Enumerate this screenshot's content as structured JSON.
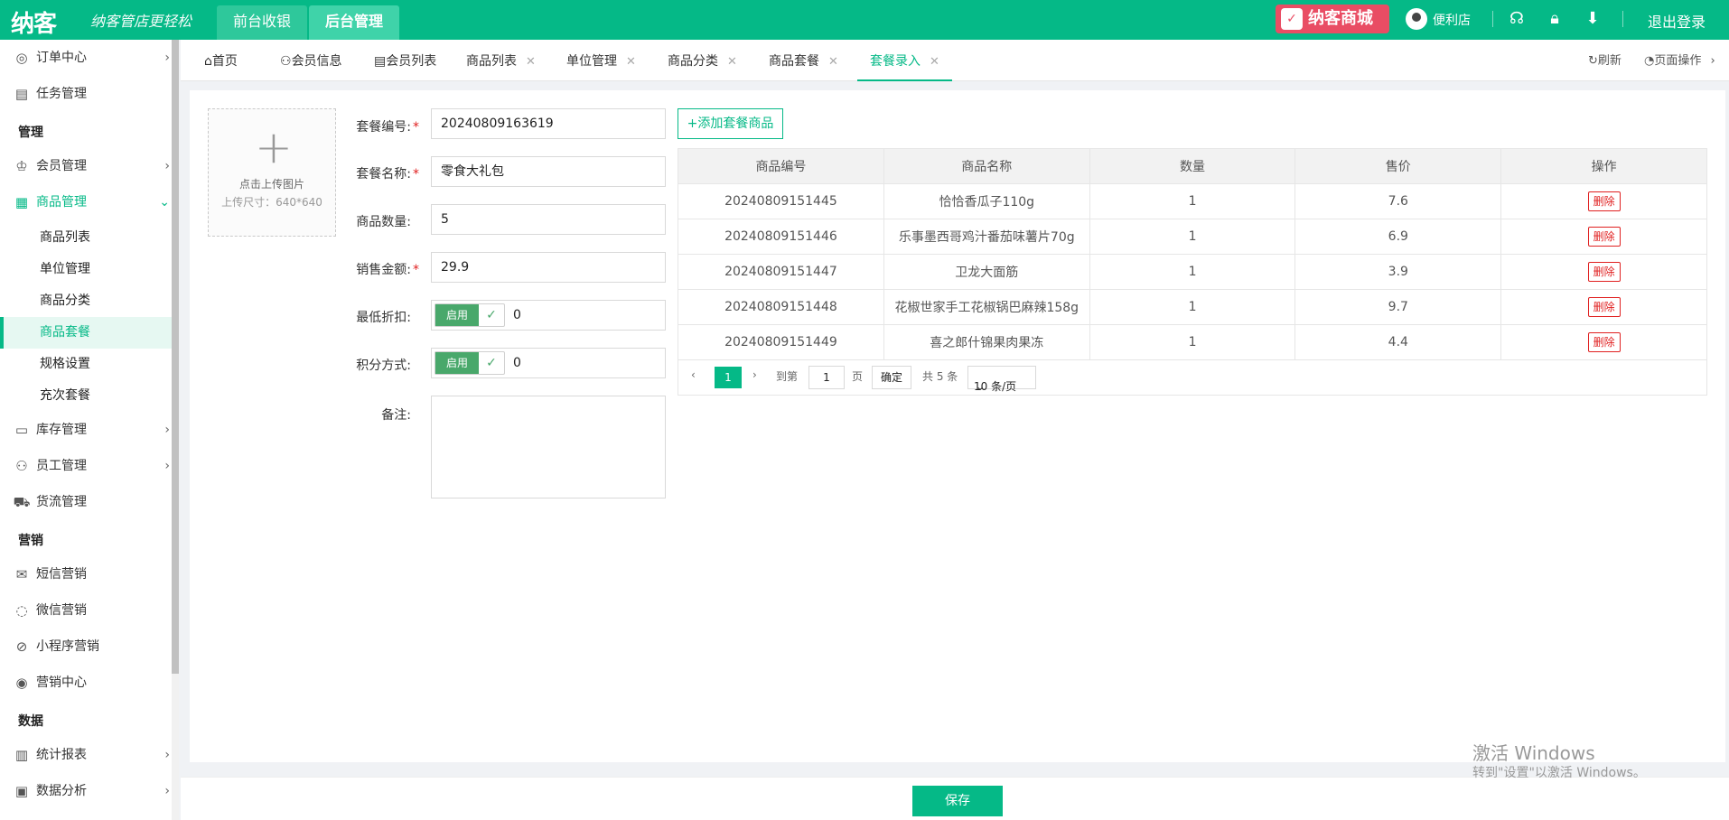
{
  "header": {
    "logo": "纳客",
    "slogan": "纳客管店更轻松",
    "nav_front": "前台收银",
    "nav_back": "后台管理",
    "mall": "纳客商城",
    "user": "便利店",
    "logout": "退出登录"
  },
  "sidebar": {
    "order_center": "订单中心",
    "task_manage": "任务管理",
    "group_manage": "管理",
    "member_manage": "会员管理",
    "goods_manage": "商品管理",
    "goods_list": "商品列表",
    "unit_manage": "单位管理",
    "goods_category": "商品分类",
    "goods_package": "商品套餐",
    "spec_setting": "规格设置",
    "recharge_package": "充次套餐",
    "stock_manage": "库存管理",
    "staff_manage": "员工管理",
    "logistics_manage": "货流管理",
    "group_marketing": "营销",
    "sms_marketing": "短信营销",
    "wechat_marketing": "微信营销",
    "miniapp_marketing": "小程序营销",
    "marketing_center": "营销中心",
    "group_data": "数据",
    "stat_report": "统计报表",
    "data_analysis": "数据分析"
  },
  "tabs": {
    "home": "首页",
    "member_info": "会员信息",
    "member_list": "会员列表",
    "goods_list": "商品列表",
    "unit_manage": "单位管理",
    "goods_category": "商品分类",
    "goods_package": "商品套餐",
    "package_entry": "套餐录入",
    "refresh": "刷新",
    "page_ops": "页面操作"
  },
  "upload": {
    "text": "点击上传图片",
    "size": "上传尺寸：640*640"
  },
  "form": {
    "code_label": "套餐编号:",
    "code_value": "20240809163619",
    "name_label": "套餐名称:",
    "name_value": "零食大礼包",
    "qty_label": "商品数量:",
    "qty_value": "5",
    "amount_label": "销售金额:",
    "amount_value": "29.9",
    "discount_label": "最低折扣:",
    "discount_toggle": "启用",
    "discount_value": "0",
    "points_label": "积分方式:",
    "points_toggle": "启用",
    "points_value": "0",
    "remark_label": "备注:"
  },
  "add_button": "+添加套餐商品",
  "table": {
    "headers": [
      "商品编号",
      "商品名称",
      "数量",
      "售价",
      "操作"
    ],
    "rows": [
      {
        "code": "20240809151445",
        "name": "恰恰香瓜子110g",
        "qty": "1",
        "price": "7.6",
        "action": "删除"
      },
      {
        "code": "20240809151446",
        "name": "乐事墨西哥鸡汁番茄味薯片70g",
        "qty": "1",
        "price": "6.9",
        "action": "删除"
      },
      {
        "code": "20240809151447",
        "name": "卫龙大面筋",
        "qty": "1",
        "price": "3.9",
        "action": "删除"
      },
      {
        "code": "20240809151448",
        "name": "花椒世家手工花椒锅巴麻辣158g",
        "qty": "1",
        "price": "9.7",
        "action": "删除"
      },
      {
        "code": "20240809151449",
        "name": "喜之郎什锦果肉果冻",
        "qty": "1",
        "price": "4.4",
        "action": "删除"
      }
    ]
  },
  "pager": {
    "current": "1",
    "goto": "到第",
    "page_input": "1",
    "page_unit": "页",
    "confirm": "确定",
    "total": "共 5 条",
    "page_size": "10 条/页"
  },
  "save_button": "保存",
  "watermark": {
    "line1": "激活 Windows",
    "line2": "转到\"设置\"以激活 Windows。"
  },
  "colors": {
    "brand": "#05b987",
    "danger": "#e02020"
  }
}
